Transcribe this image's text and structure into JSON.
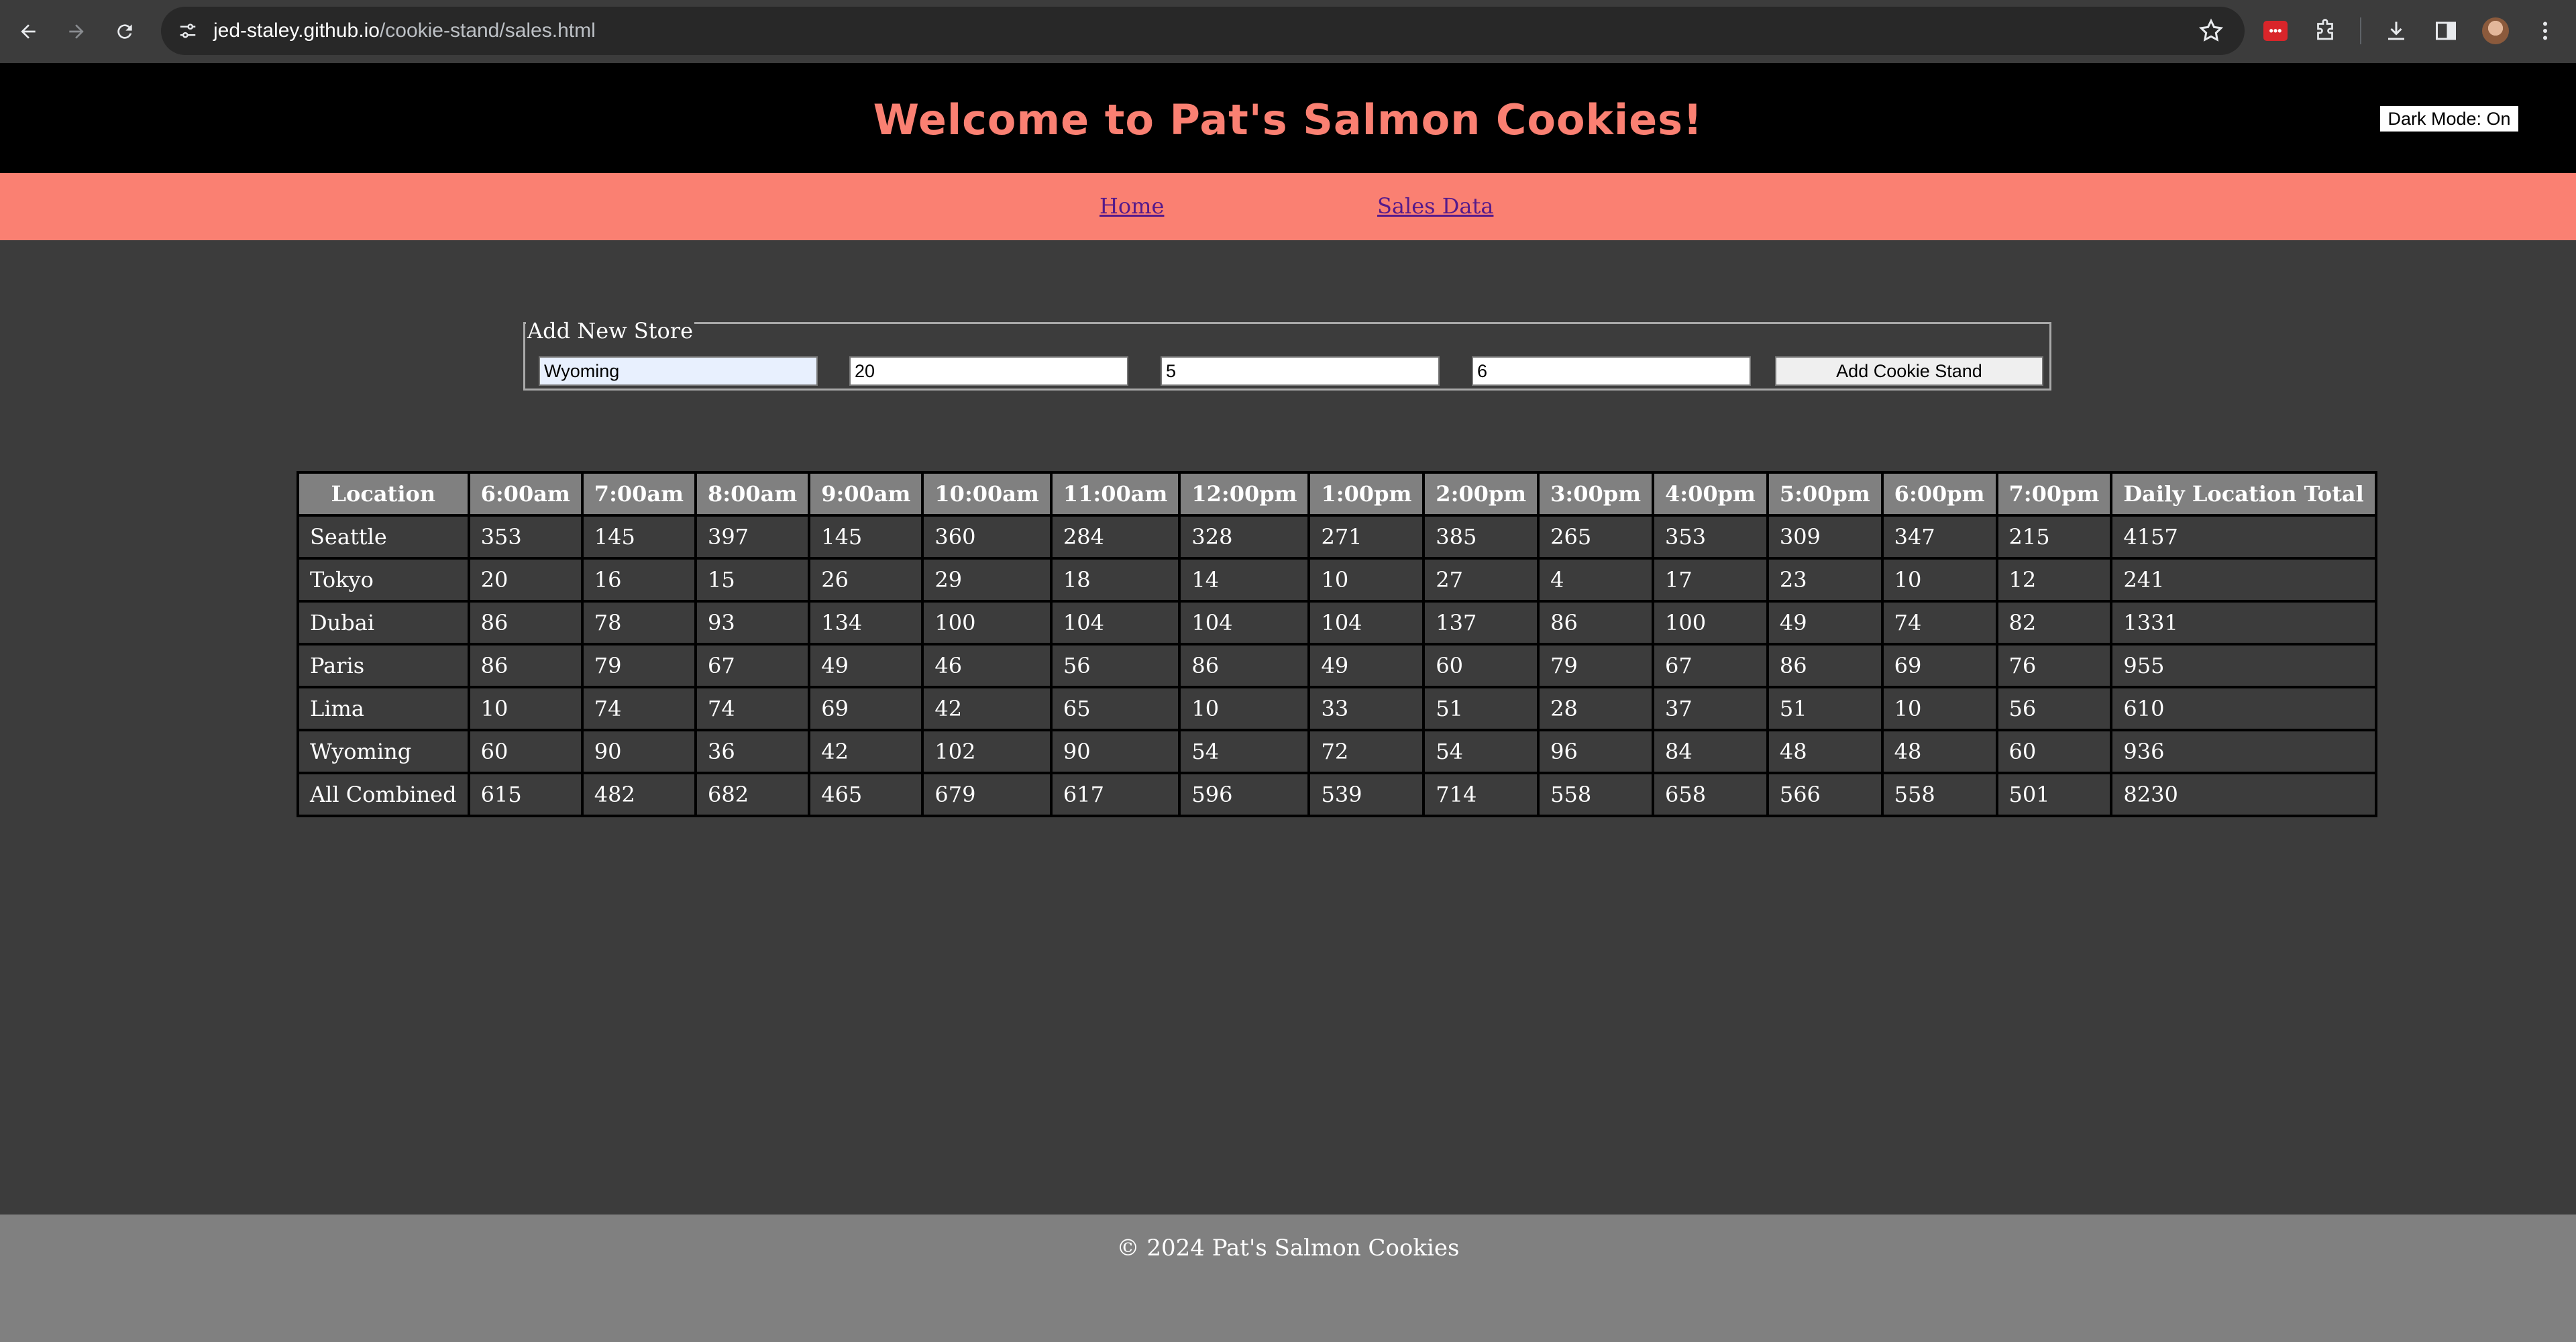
{
  "browser": {
    "url_host": "jed-staley.github.io",
    "url_path": "/cookie-stand/sales.html"
  },
  "header": {
    "title": "Welcome to Pat's Salmon Cookies!",
    "dark_mode_label": "Dark Mode: On"
  },
  "nav": {
    "home": "Home",
    "sales": "Sales Data"
  },
  "form": {
    "legend": "Add New Store",
    "location_value": "Wyoming",
    "min_value": "20",
    "max_value": "5",
    "avg_value": "6",
    "submit_label": "Add Cookie Stand"
  },
  "table": {
    "headers": [
      "Location",
      "6:00am",
      "7:00am",
      "8:00am",
      "9:00am",
      "10:00am",
      "11:00am",
      "12:00pm",
      "1:00pm",
      "2:00pm",
      "3:00pm",
      "4:00pm",
      "5:00pm",
      "6:00pm",
      "7:00pm",
      "Daily Location Total"
    ],
    "rows": [
      [
        "Seattle",
        "353",
        "145",
        "397",
        "145",
        "360",
        "284",
        "328",
        "271",
        "385",
        "265",
        "353",
        "309",
        "347",
        "215",
        "4157"
      ],
      [
        "Tokyo",
        "20",
        "16",
        "15",
        "26",
        "29",
        "18",
        "14",
        "10",
        "27",
        "4",
        "17",
        "23",
        "10",
        "12",
        "241"
      ],
      [
        "Dubai",
        "86",
        "78",
        "93",
        "134",
        "100",
        "104",
        "104",
        "104",
        "137",
        "86",
        "100",
        "49",
        "74",
        "82",
        "1331"
      ],
      [
        "Paris",
        "86",
        "79",
        "67",
        "49",
        "46",
        "56",
        "86",
        "49",
        "60",
        "79",
        "67",
        "86",
        "69",
        "76",
        "955"
      ],
      [
        "Lima",
        "10",
        "74",
        "74",
        "69",
        "42",
        "65",
        "10",
        "33",
        "51",
        "28",
        "37",
        "51",
        "10",
        "56",
        "610"
      ],
      [
        "Wyoming",
        "60",
        "90",
        "36",
        "42",
        "102",
        "90",
        "54",
        "72",
        "54",
        "96",
        "84",
        "48",
        "48",
        "60",
        "936"
      ]
    ],
    "footer": [
      "All Combined",
      "615",
      "482",
      "682",
      "465",
      "679",
      "617",
      "596",
      "539",
      "714",
      "558",
      "658",
      "566",
      "558",
      "501",
      "8230"
    ]
  },
  "footer": {
    "text": "© 2024 Pat's Salmon Cookies"
  }
}
